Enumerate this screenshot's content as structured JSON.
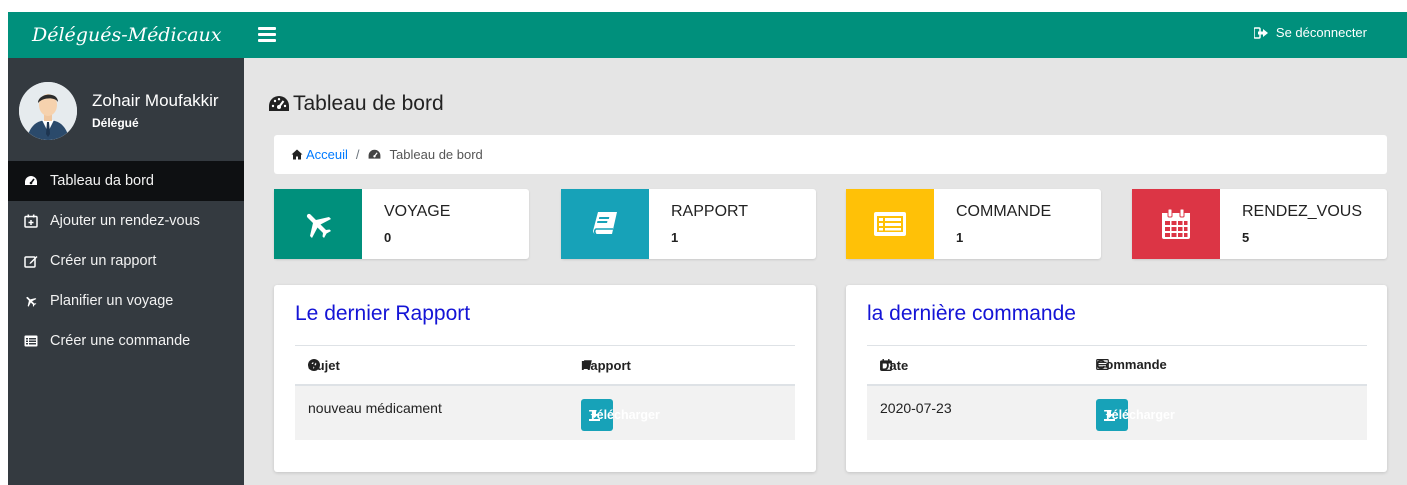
{
  "brand": "Délégués-Médicaux",
  "user": {
    "name": "Zohair Moufakkir",
    "role": "Délégué"
  },
  "nav": [
    {
      "label": "Tableau da bord",
      "icon": "tachometer-icon"
    },
    {
      "label": "Ajouter un rendez-vous",
      "icon": "calendar-plus-icon"
    },
    {
      "label": "Créer un rapport",
      "icon": "edit-icon"
    },
    {
      "label": "Planifier un voyage",
      "icon": "plane-icon"
    },
    {
      "label": "Créer une commande",
      "icon": "list-alt-icon"
    }
  ],
  "topbar": {
    "logout_label": "Se déconnecter"
  },
  "page": {
    "title": "Tableau de bord"
  },
  "breadcrumb": {
    "home": "Acceuil",
    "separator": "/",
    "current": "Tableau de bord"
  },
  "stats": [
    {
      "label": "VOYAGE",
      "value": "0",
      "color": "#00907c",
      "icon": "plane-icon"
    },
    {
      "label": "RAPPORT",
      "value": "1",
      "color": "#17a2b8",
      "icon": "book-icon"
    },
    {
      "label": "COMMANDE",
      "value": "1",
      "color": "#ffc107",
      "icon": "list-alt-icon"
    },
    {
      "label": "RENDEZ_VOUS",
      "value": "5",
      "color": "#dc3545",
      "icon": "calendar-icon"
    }
  ],
  "rapport_card": {
    "title": "Le dernier Rapport",
    "headers": [
      "Sujet",
      "Rapport"
    ],
    "row": {
      "sujet": "nouveau médicament",
      "button": "Télécharger"
    }
  },
  "commande_card": {
    "title": "la dernière commande",
    "headers": [
      "Date",
      "Commande"
    ],
    "row": {
      "date": "2020-07-23",
      "button": "Télécharger"
    }
  },
  "colors": {
    "primary": "#00907c",
    "sidebar": "#343a40",
    "accent_title": "#1414d6",
    "button": "#17a2b8"
  }
}
